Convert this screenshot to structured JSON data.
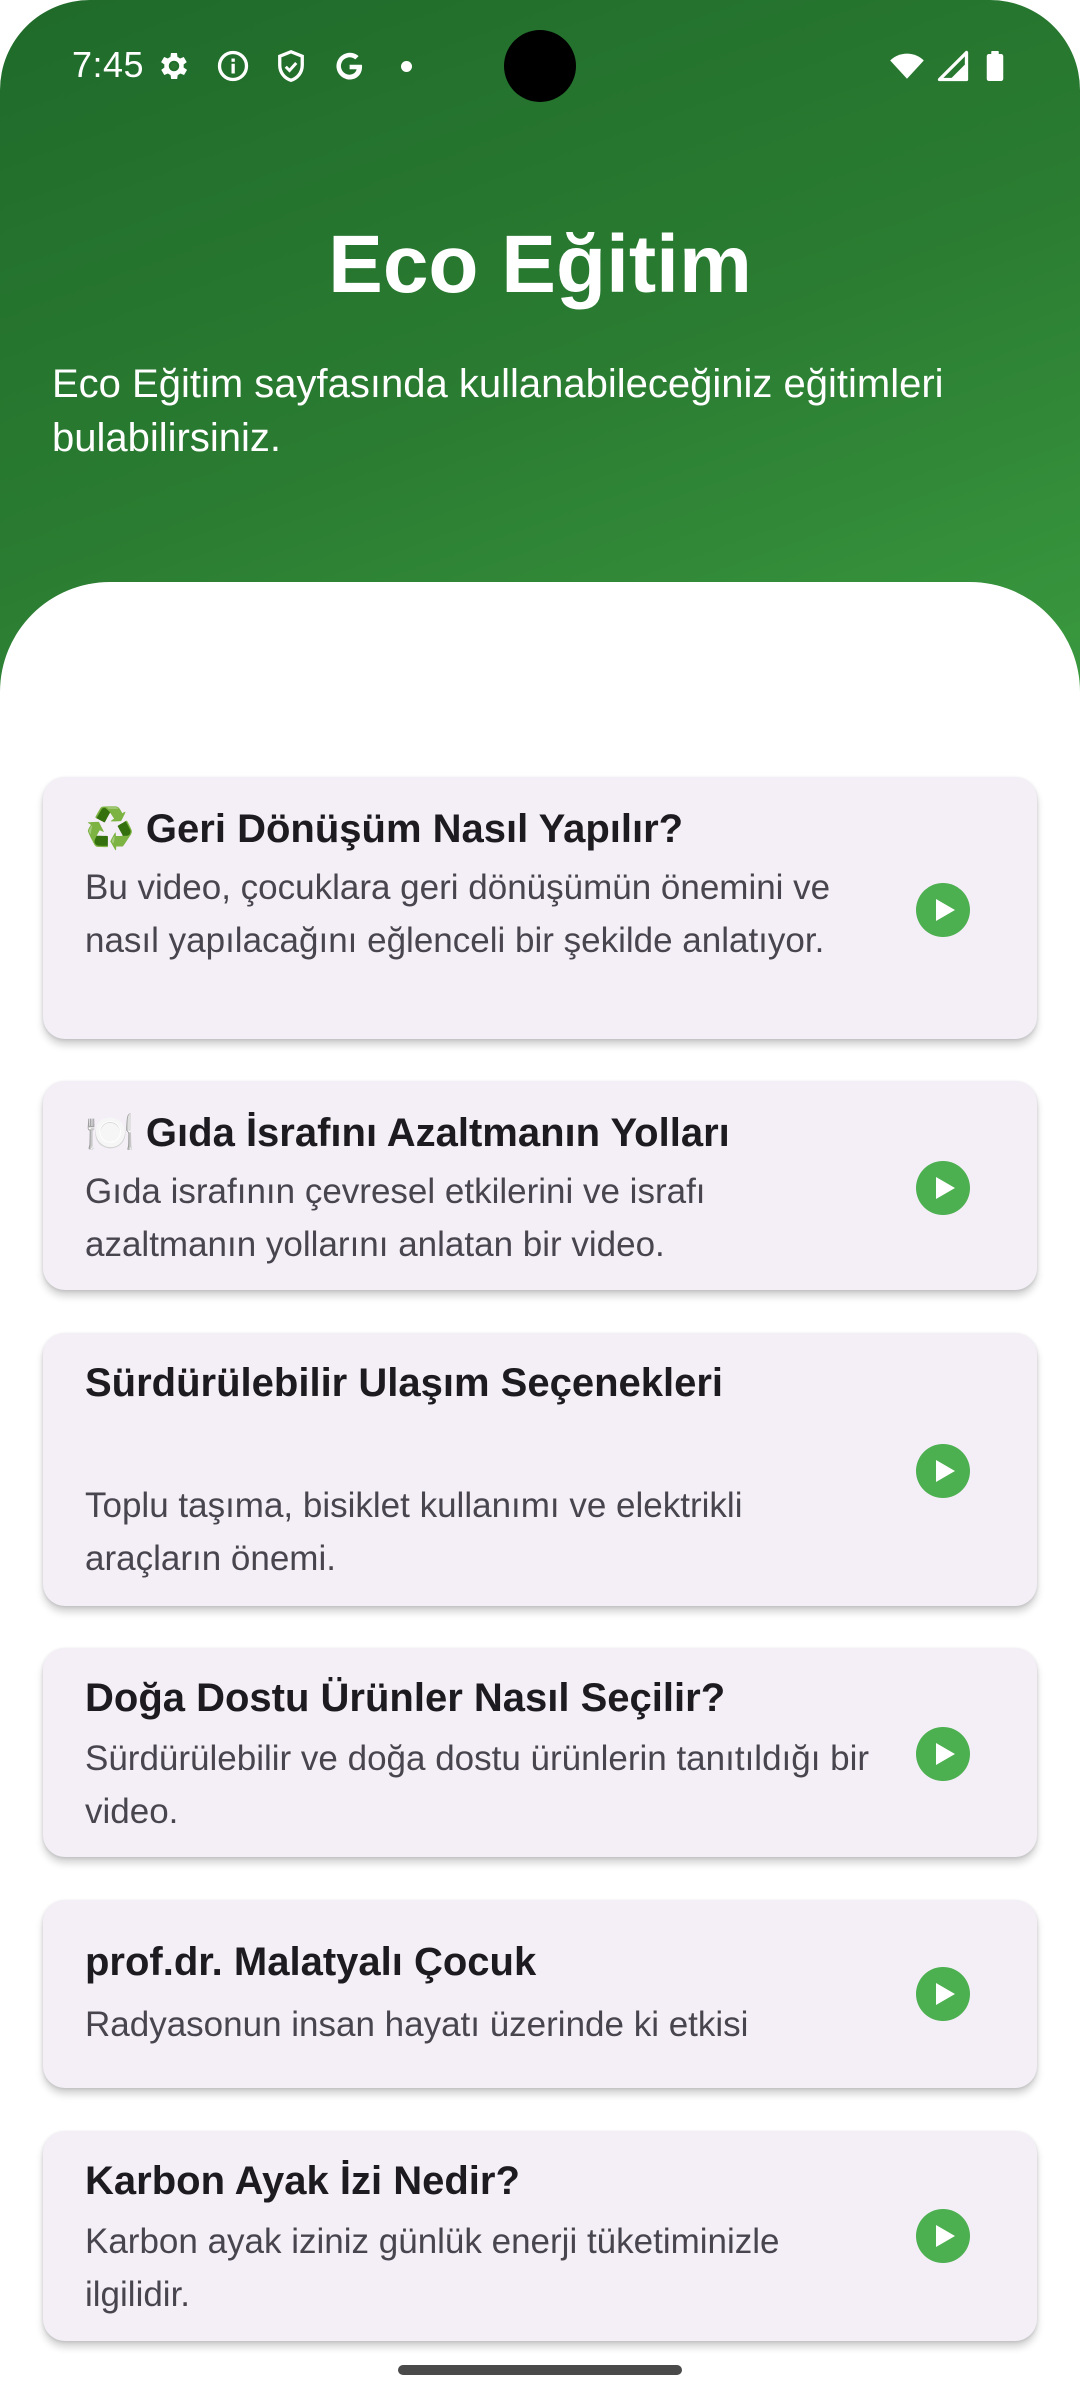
{
  "status_bar": {
    "time": "7:45",
    "icons": [
      "settings-icon",
      "info-icon",
      "shield-icon",
      "google-icon",
      "notification-dot-icon",
      "wifi-icon",
      "signal-icon",
      "battery-icon"
    ]
  },
  "header": {
    "title": "Eco Eğitim",
    "subtitle": "Eco Eğitim sayfasında kullanabileceğiniz eğitimleri bulabilirsiniz."
  },
  "colors": {
    "header_gradient_start": "#1f6a2a",
    "header_gradient_end": "#3a9a3f",
    "card_background": "#f4eff7",
    "play_button": "#4caf50"
  },
  "videos": [
    {
      "title": "♻️ Geri Dönüşüm Nasıl Yapılır?",
      "description": "Bu video, çocuklara geri dönüşümün önemini ve nasıl yapılacağını eğlenceli bir şekilde anlatıyor."
    },
    {
      "title": "🍽️ Gıda İsrafını Azaltmanın Yolları",
      "description": "Gıda israfının çevresel etkilerini ve israfı azaltmanın yollarını anlatan bir video."
    },
    {
      "title": "Sürdürülebilir Ulaşım Seçenekleri",
      "description": "Toplu taşıma, bisiklet kullanımı ve elektrikli araçların önemi."
    },
    {
      "title": " Doğa Dostu Ürünler Nasıl Seçilir?",
      "description": "Sürdürülebilir ve doğa dostu ürünlerin tanıtıldığı bir video."
    },
    {
      "title": "prof.dr. Malatyalı Çocuk",
      "description": "Radyasonun insan hayatı üzerinde ki etkisi"
    },
    {
      "title": "Karbon Ayak İzi Nedir?",
      "description": "Karbon ayak iziniz günlük enerji tüketiminizle ilgilidir."
    }
  ]
}
